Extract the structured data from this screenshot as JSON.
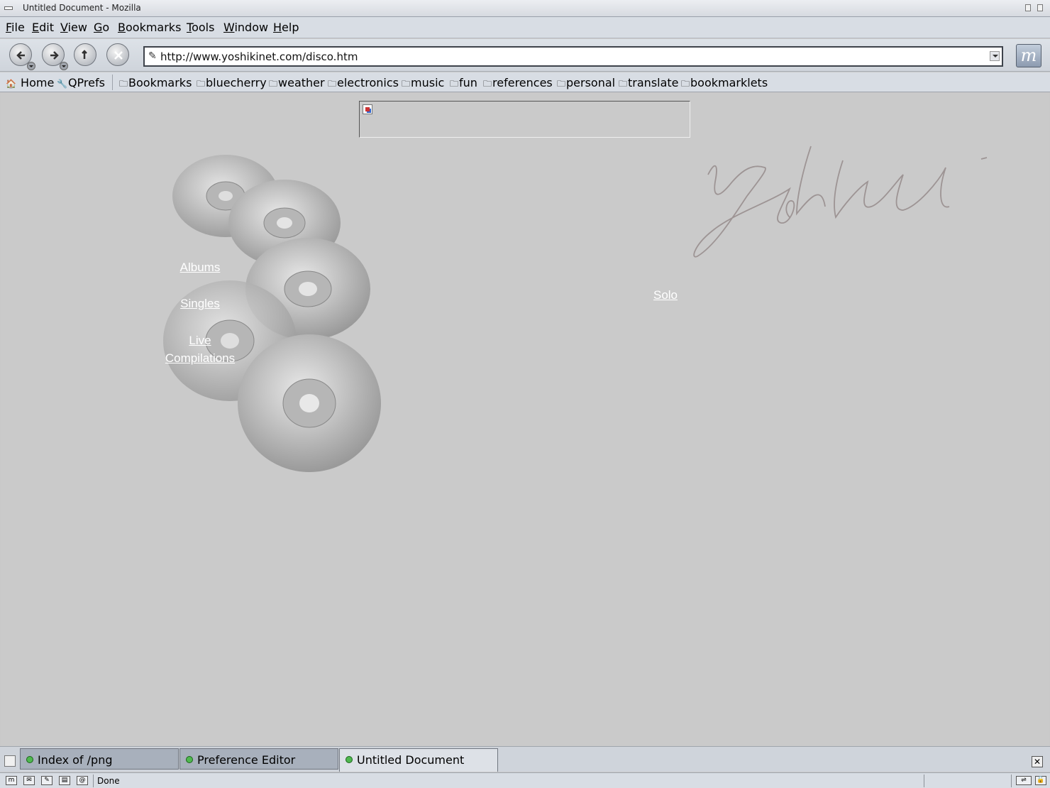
{
  "window": {
    "title": "Untitled Document - Mozilla"
  },
  "menu": [
    "File",
    "Edit",
    "View",
    "Go",
    "Bookmarks",
    "Tools",
    "Window",
    "Help"
  ],
  "navigation": {
    "url": "http://www.yoshikinet.com/disco.htm",
    "throbber_glyph": "m"
  },
  "personal_toolbar": {
    "home": "Home",
    "qprefs": "QPrefs",
    "folders": [
      "Bookmarks",
      "bluecherry",
      "weather",
      "electronics",
      "music",
      "fun",
      "references",
      "personal",
      "translate",
      "bookmarklets"
    ]
  },
  "content": {
    "links": {
      "albums": "Albums",
      "singles": "Singles",
      "live": "Live",
      "compilations": "Compilations",
      "solo": "Solo"
    }
  },
  "tabs": [
    {
      "label": "Index of /png",
      "active": false
    },
    {
      "label": "Preference Editor",
      "active": false
    },
    {
      "label": "Untitled Document",
      "active": true
    }
  ],
  "status": {
    "text": "Done"
  }
}
